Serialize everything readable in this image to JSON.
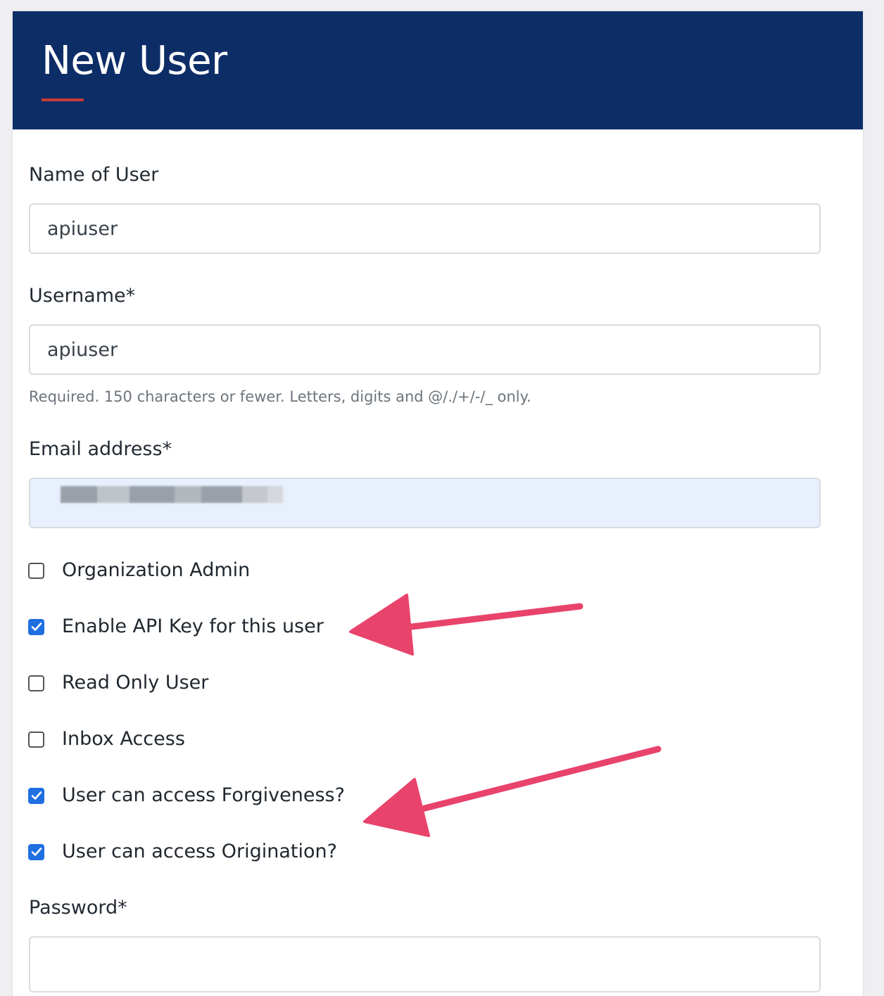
{
  "header": {
    "title": "New User"
  },
  "form": {
    "name": {
      "label": "Name of User",
      "value": "apiuser"
    },
    "username": {
      "label": "Username*",
      "value": "apiuser",
      "help": "Required. 150 characters or fewer. Letters, digits and @/./+/-/_ only."
    },
    "email": {
      "label": "Email address*",
      "value": ""
    },
    "checkboxes": [
      {
        "label": "Organization Admin",
        "checked": false
      },
      {
        "label": "Enable API Key for this user",
        "checked": true
      },
      {
        "label": "Read Only User",
        "checked": false
      },
      {
        "label": "Inbox Access",
        "checked": false
      },
      {
        "label": "User can access Forgiveness?",
        "checked": true
      },
      {
        "label": "User can access Origination?",
        "checked": true
      }
    ],
    "password": {
      "label": "Password*",
      "value": ""
    }
  },
  "colors": {
    "header_bg": "#0d2d67",
    "accent": "#c83b33",
    "checkbox_checked": "#1f6fe1",
    "annotation_arrow": "#e8436b"
  },
  "icons": {
    "checkmark": "check-icon",
    "annotation": "arrow-annotation-icon"
  }
}
